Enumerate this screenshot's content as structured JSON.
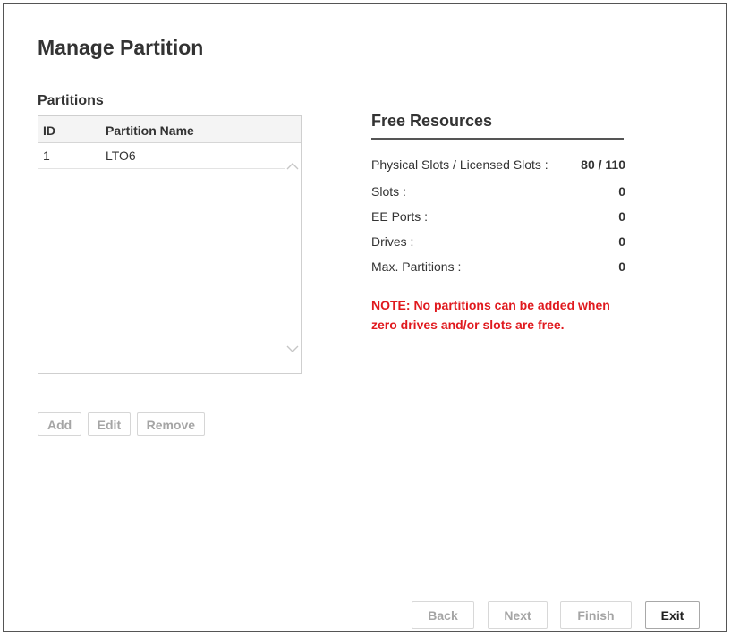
{
  "page": {
    "title": "Manage Partition"
  },
  "partitions": {
    "heading": "Partitions",
    "columns": {
      "id": "ID",
      "name": "Partition Name"
    },
    "rows": [
      {
        "id": "1",
        "name": "LTO6"
      }
    ],
    "buttons": {
      "add": "Add",
      "edit": "Edit",
      "remove": "Remove"
    }
  },
  "free_resources": {
    "title": "Free Resources",
    "items": [
      {
        "label": "Physical Slots / Licensed Slots :",
        "value": "80 / 110"
      },
      {
        "label": "Slots :",
        "value": "0"
      },
      {
        "label": "EE Ports :",
        "value": "0"
      },
      {
        "label": "Drives :",
        "value": "0"
      },
      {
        "label": "Max. Partitions :",
        "value": "0"
      }
    ],
    "note_line1": "NOTE: No partitions can be added when",
    "note_line2": "zero drives and/or slots are free."
  },
  "footer": {
    "back": "Back",
    "next": "Next",
    "finish": "Finish",
    "exit": "Exit"
  },
  "icons": {
    "scroll_up": "chevron-up-icon",
    "scroll_down": "chevron-down-icon"
  },
  "colors": {
    "note": "#e0191e",
    "disabled_text": "#a5a5a5"
  }
}
